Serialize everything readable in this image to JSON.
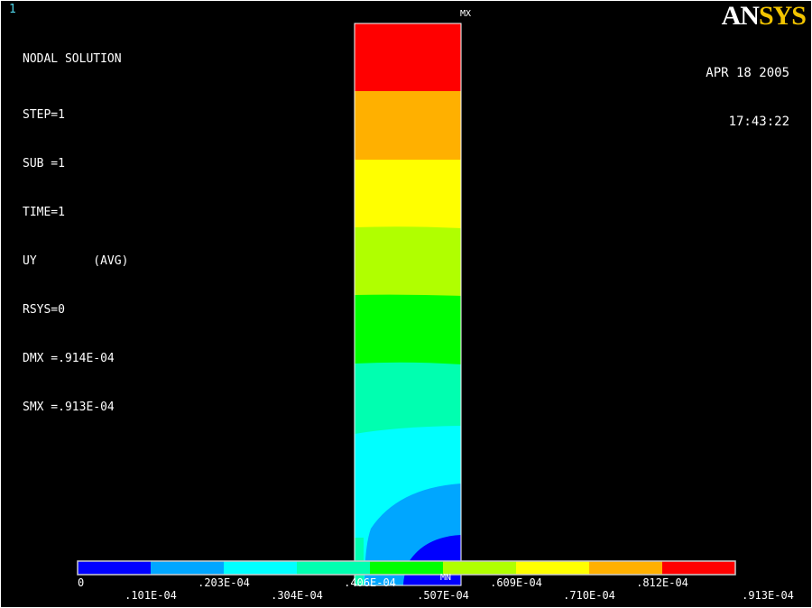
{
  "corner_number": "1",
  "info": {
    "title": "NODAL SOLUTION",
    "lines": [
      "STEP=1",
      "SUB =1",
      "TIME=1",
      "UY        (AVG)",
      "RSYS=0",
      "DMX =.914E-04",
      "SMX =.913E-04"
    ]
  },
  "datetime": {
    "date": "APR 18 2005",
    "time": "17:43:22"
  },
  "logo": {
    "part1": "AN",
    "part2": "SYS"
  },
  "markers": {
    "max": "MX",
    "min": "MN"
  },
  "legend": {
    "colors": [
      "#0000ff",
      "#00a6ff",
      "#00ffff",
      "#00ffb0",
      "#00ff00",
      "#b0ff00",
      "#ffff00",
      "#ffb000",
      "#ff0000"
    ],
    "top_labels": [
      "0",
      ".203E-04",
      ".406E-04",
      ".609E-04",
      ".812E-04"
    ],
    "bottom_labels": [
      ".101E-04",
      ".304E-04",
      ".507E-04",
      ".710E-04",
      ".913E-04"
    ]
  }
}
